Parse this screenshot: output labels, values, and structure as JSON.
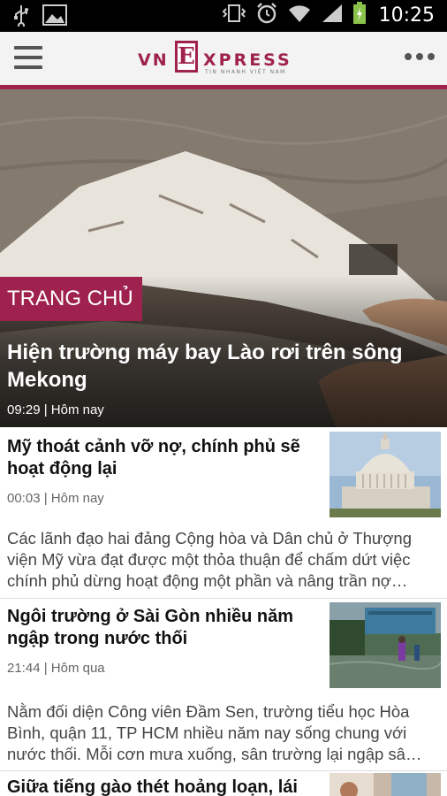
{
  "status_bar": {
    "time": "10:25",
    "left_icons": [
      "usb-icon",
      "image-icon"
    ],
    "right_icons": [
      "vibrate-icon",
      "alarm-icon",
      "wifi-icon",
      "signal-icon",
      "battery-charging-icon"
    ]
  },
  "app_bar": {
    "logo_left": "VN",
    "logo_e": "E",
    "logo_right": "XPRESS",
    "logo_tagline": "TIN NHANH VIỆT NAM",
    "accent_color": "#9f224e"
  },
  "hero": {
    "section_label": "TRANG CHỦ",
    "title": "Hiện trường máy bay Lào rơi trên sông Mekong",
    "meta": "09:29 | Hôm nay"
  },
  "articles": [
    {
      "title": "Mỹ thoát cảnh vỡ nợ, chính phủ sẽ hoạt động lại",
      "meta": "00:03 | Hôm nay",
      "summary": "Các lãnh đạo hai đảng Cộng hòa và Dân chủ ở Thượng viện Mỹ vừa đạt được một thỏa thuận để chấm dứt việc chính phủ dừng hoạt động một phần và nâng trần nợ…"
    },
    {
      "title": "Ngôi trường ở Sài Gòn nhiều năm ngập trong nước thối",
      "meta": "21:44 | Hôm qua",
      "summary": "Nằm đối diện Công viên Đầm Sen, trường tiểu học Hòa Bình, quận 11, TP HCM nhiều năm nay sống chung với nước thối. Mỗi cơn mưa xuống, sân trường lại ngập sâ…"
    },
    {
      "title": "Giữa tiếng gào thét hoảng loạn, lái xe"
    }
  ]
}
